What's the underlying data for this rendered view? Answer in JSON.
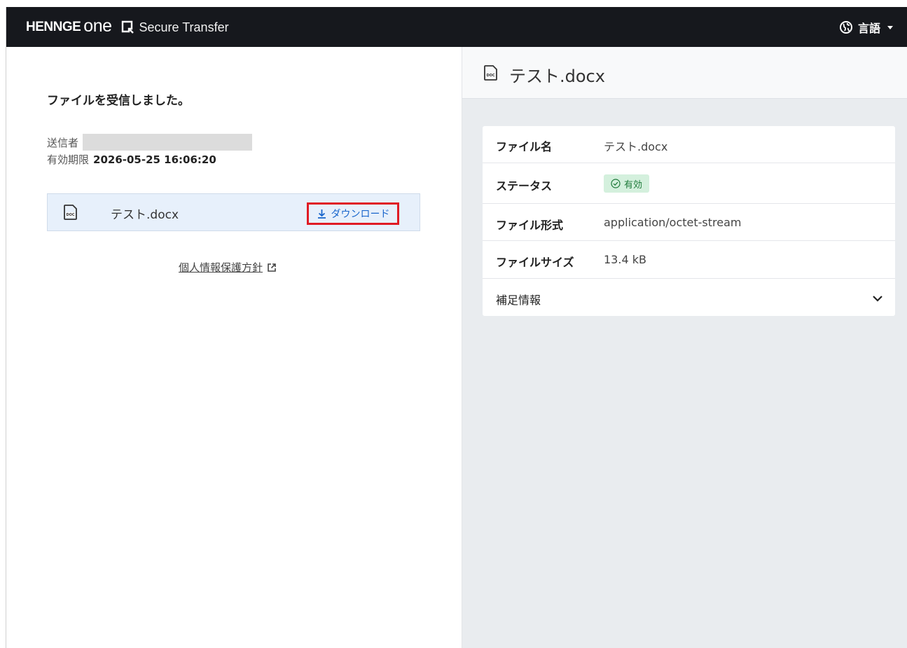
{
  "header": {
    "brand_hennge": "HENNGE",
    "brand_one": "one",
    "product": "Secure Transfer",
    "language_label": "言語"
  },
  "left": {
    "received_title": "ファイルを受信しました。",
    "sender_label": "送信者",
    "expiry_label": "有効期限",
    "expiry_value": "2026-05-25 16:06:20",
    "file": {
      "name": "テスト.docx",
      "icon": "doc-file-icon"
    },
    "download_label": "ダウンロード",
    "privacy_link": "個人情報保護方針"
  },
  "right": {
    "title": "テスト.docx",
    "details": {
      "file_name_label": "ファイル名",
      "file_name_value": "テスト.docx",
      "status_label": "ステータス",
      "status_value": "有効",
      "type_label": "ファイル形式",
      "type_value": "application/octet-stream",
      "size_label": "ファイルサイズ",
      "size_value": "13.4 kB",
      "extra_label": "補足情報"
    }
  },
  "colors": {
    "topbar": "#16181d",
    "download_highlight": "#e01b24",
    "link_blue": "#1a66cc",
    "status_bg": "#d4f0dd",
    "status_fg": "#1e7a3a"
  }
}
